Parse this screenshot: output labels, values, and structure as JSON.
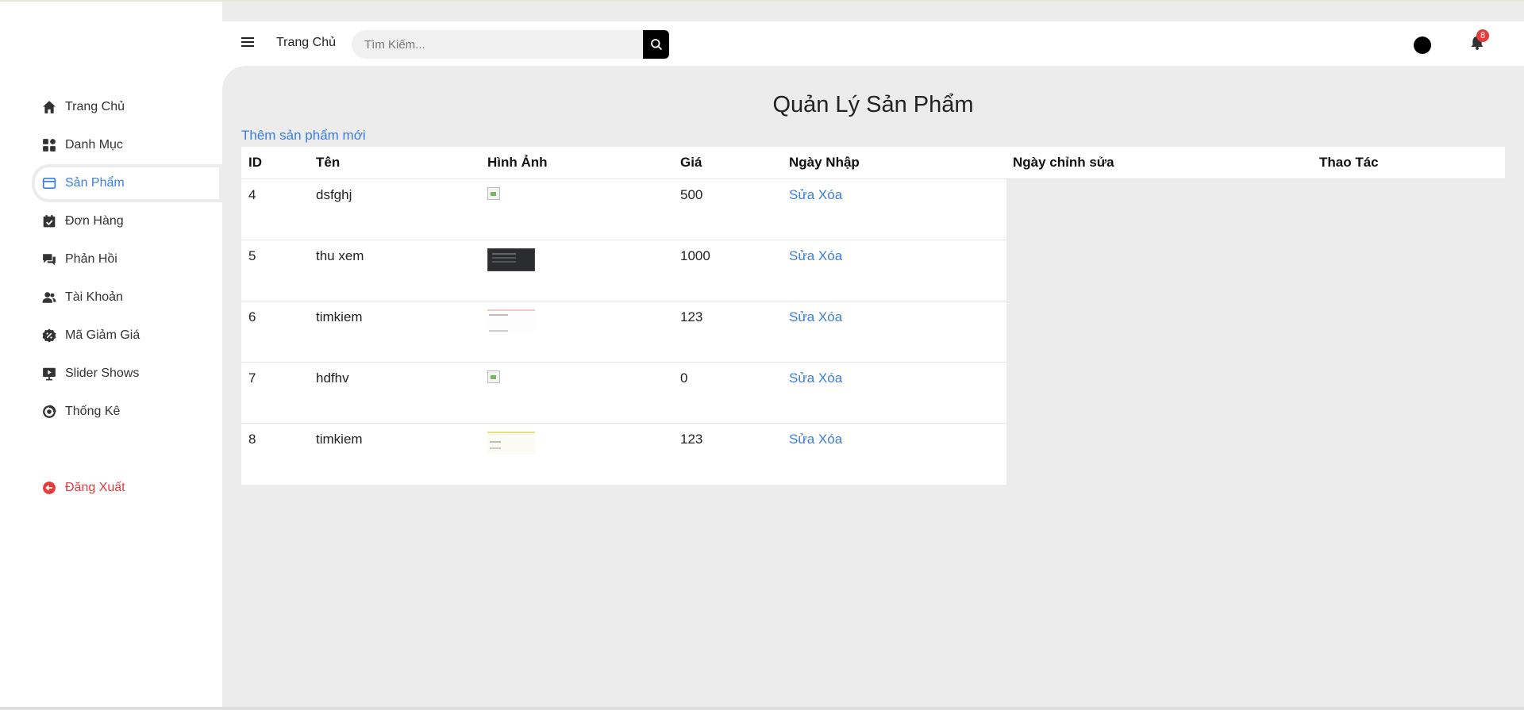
{
  "sidebar": {
    "items": [
      {
        "label": "Trang Chủ",
        "icon": "home-icon"
      },
      {
        "label": "Danh Mục",
        "icon": "grid-icon"
      },
      {
        "label": "Sản Phẩm",
        "icon": "window-icon",
        "active": true
      },
      {
        "label": "Đơn Hàng",
        "icon": "calendar-check-icon"
      },
      {
        "label": "Phản Hồi",
        "icon": "chat-icon"
      },
      {
        "label": "Tài Khoản",
        "icon": "users-icon"
      },
      {
        "label": "Mã Giảm Giá",
        "icon": "discount-icon"
      },
      {
        "label": "Slider Shows",
        "icon": "presentation-icon"
      },
      {
        "label": "Thống Kê",
        "icon": "chart-circle-icon"
      }
    ],
    "logout": {
      "label": "Đăng Xuất",
      "icon": "logout-icon"
    }
  },
  "header": {
    "home_link": "Trang Chủ",
    "search_placeholder": "Tìm Kiếm...",
    "notification_count": "8"
  },
  "main": {
    "title": "Quản Lý Sản Phẩm",
    "add_link": "Thêm sản phẩm mới",
    "columns": [
      "ID",
      "Tên",
      "Hình Ảnh",
      "Giá",
      "Ngày Nhập",
      "Ngày chỉnh sửa",
      "Thao Tác"
    ],
    "rows": [
      {
        "id": "4",
        "name": "dsfghj",
        "image": "broken",
        "price": "500",
        "edit": "Sửa",
        "delete": "Xóa"
      },
      {
        "id": "5",
        "name": "thu xem",
        "image": "dark",
        "price": "1000",
        "edit": "Sửa",
        "delete": "Xóa"
      },
      {
        "id": "6",
        "name": "timkiem",
        "image": "light",
        "price": "123",
        "edit": "Sửa",
        "delete": "Xóa"
      },
      {
        "id": "7",
        "name": "hdfhv",
        "image": "broken",
        "price": "0",
        "edit": "Sửa",
        "delete": "Xóa"
      },
      {
        "id": "8",
        "name": "timkiem",
        "image": "light2",
        "price": "123",
        "edit": "Sửa",
        "delete": "Xóa"
      }
    ]
  },
  "colors": {
    "accent": "#3a7ee0",
    "danger": "#e53b3b",
    "background": "#ececec"
  }
}
